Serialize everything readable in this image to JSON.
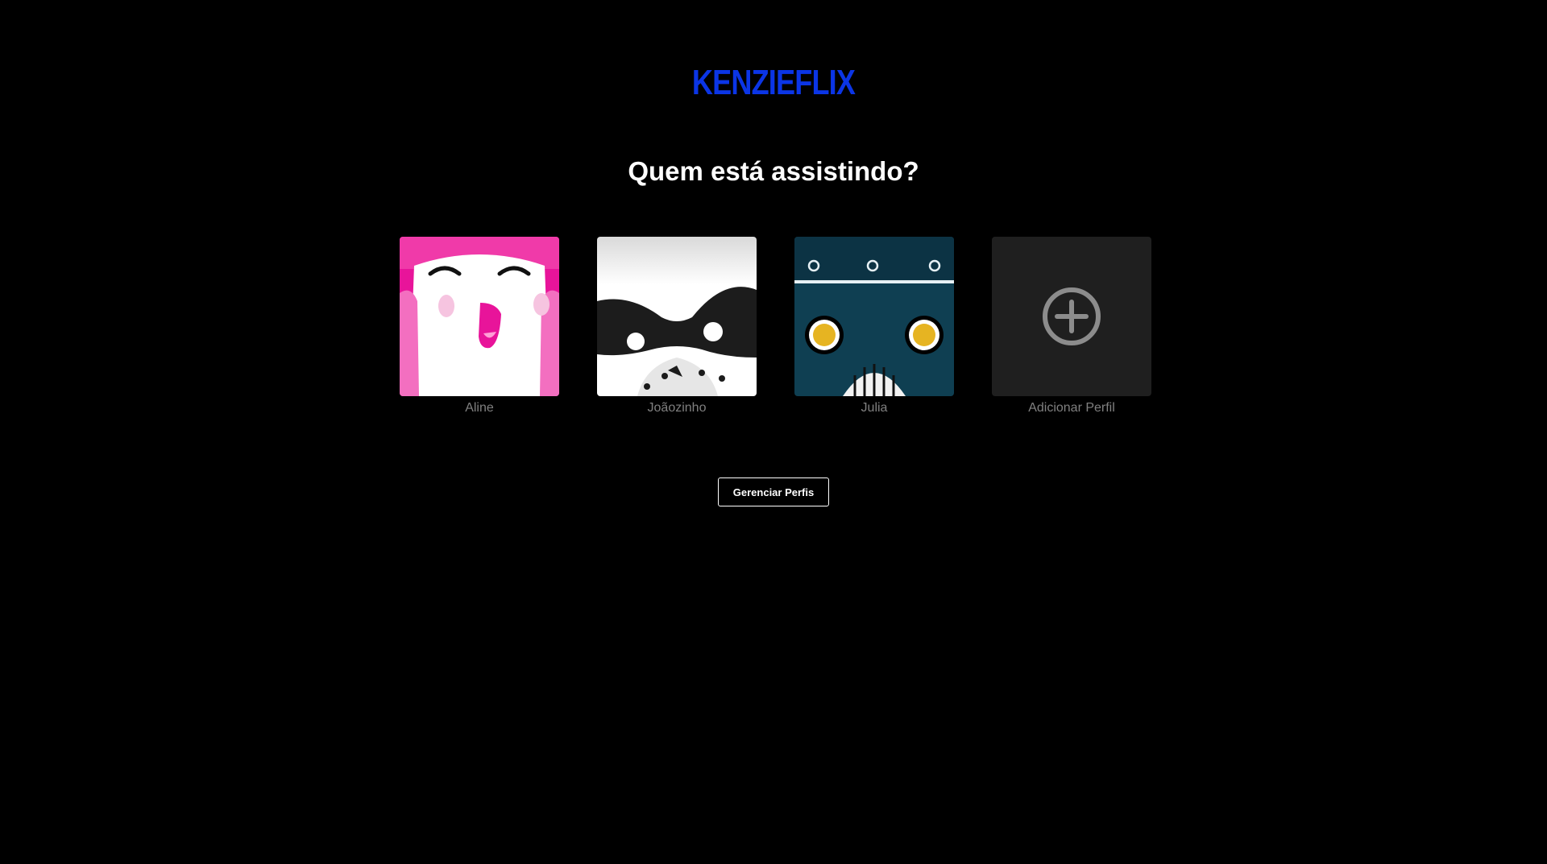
{
  "brand": {
    "logo_text": "KENZIEFLIX",
    "accent_color": "#0b35e6"
  },
  "heading": "Quem está assistindo?",
  "profiles": [
    {
      "name": "Aline",
      "avatar_icon": "pink-smiling-face-avatar",
      "color": "#e8149a"
    },
    {
      "name": "Joãozinho",
      "avatar_icon": "raccoon-mask-avatar",
      "color": "#2b2b2b"
    },
    {
      "name": "Julia",
      "avatar_icon": "teal-robot-avatar",
      "color": "#0f3f52"
    }
  ],
  "add_profile": {
    "label": "Adicionar Perfil",
    "icon": "plus-circle-icon"
  },
  "manage_button_label": "Gerenciar Perfis"
}
